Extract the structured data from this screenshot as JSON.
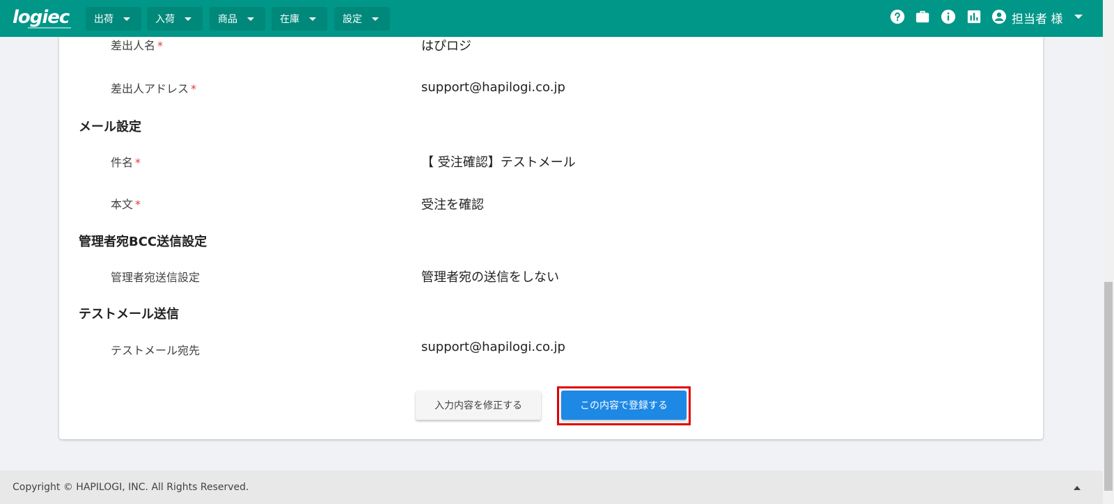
{
  "app": {
    "logo": "logiec"
  },
  "nav": [
    {
      "label": "出荷"
    },
    {
      "label": "入荷"
    },
    {
      "label": "商品"
    },
    {
      "label": "在庫"
    },
    {
      "label": "設定"
    }
  ],
  "header_icons": [
    "help-icon",
    "briefcase-icon",
    "info-icon",
    "chart-icon",
    "account-icon"
  ],
  "user": {
    "label": "担当者 様"
  },
  "form": {
    "sender_name_label": "差出人名",
    "sender_name_value": "はぴロジ",
    "sender_address_label": "差出人アドレス",
    "sender_address_value": "support@hapilogi.co.jp",
    "mail_section": "メール設定",
    "subject_label": "件名",
    "subject_value": "【 受注確認】テストメール",
    "body_label": "本文",
    "body_value": "受注を確認",
    "bcc_section": "管理者宛BCC送信設定",
    "bcc_label": "管理者宛送信設定",
    "bcc_value": "管理者宛の送信をしない",
    "test_section": "テストメール送信",
    "test_label": "テストメール宛先",
    "test_value": "support@hapilogi.co.jp",
    "required_mark": "*"
  },
  "buttons": {
    "edit": "入力内容を修正する",
    "register": "この内容で登録する"
  },
  "footer": {
    "copyright": "Copyright © HAPILOGI, INC. All Rights Reserved."
  },
  "colors": {
    "header": "#009688",
    "primary": "#1e88e5",
    "highlight": "#e00000"
  }
}
